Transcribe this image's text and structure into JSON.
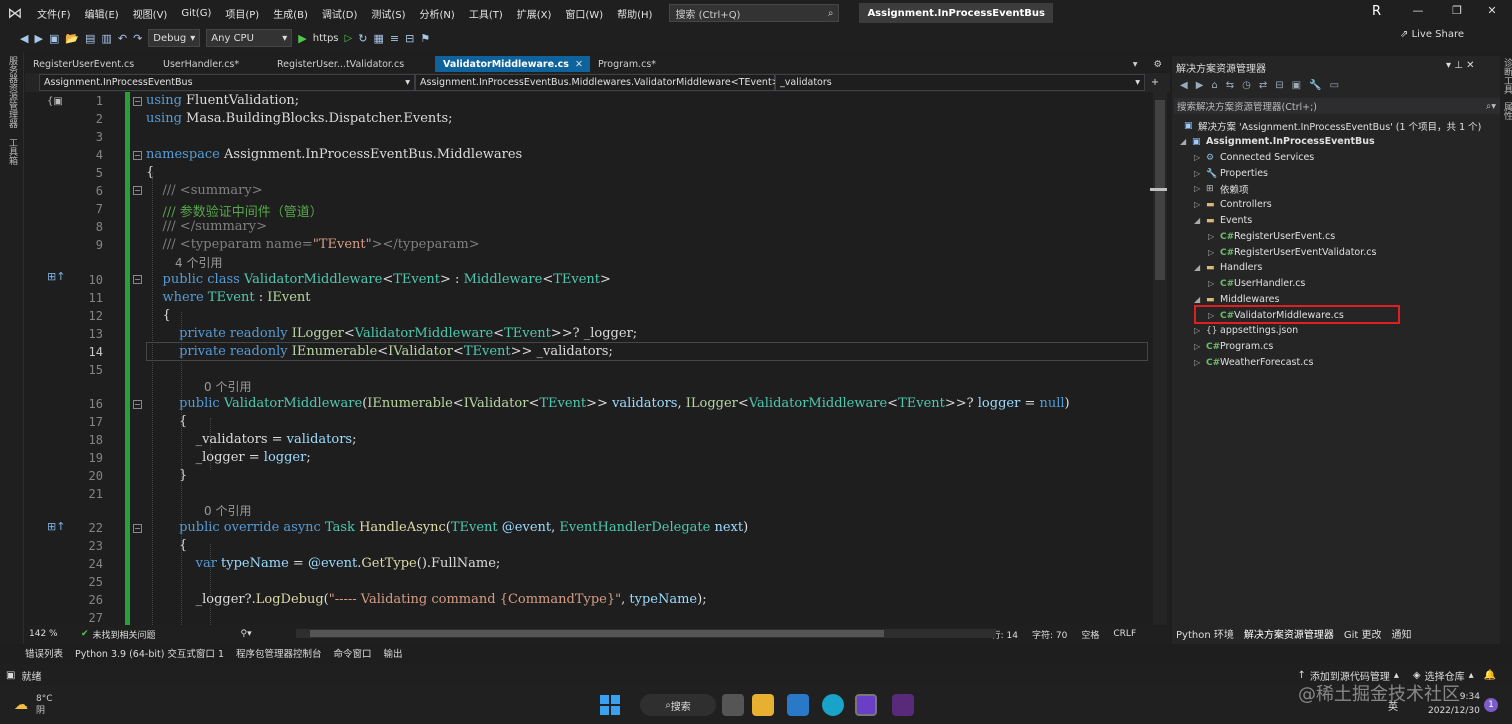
{
  "titlebar": {
    "menus": [
      "文件(F)",
      "编辑(E)",
      "视图(V)",
      "Git(G)",
      "项目(P)",
      "生成(B)",
      "调试(D)",
      "测试(S)",
      "分析(N)",
      "工具(T)",
      "扩展(X)",
      "窗口(W)",
      "帮助(H)"
    ],
    "search_placeholder": "搜索 (Ctrl+Q)",
    "solution_name": "Assignment.InProcessEventBus",
    "avatar": "R"
  },
  "toolbar": {
    "config": "Debug",
    "platform": "Any CPU",
    "run_label": "https",
    "live_share": "Live Share"
  },
  "left_strip": {
    "items": [
      "服务器资源管理器",
      "工具箱"
    ]
  },
  "tabs": [
    {
      "label": "RegisterUserEvent.cs",
      "active": false
    },
    {
      "label": "UserHandler.cs*",
      "active": false
    },
    {
      "label": "RegisterUser...tValidator.cs",
      "active": false
    },
    {
      "label": "ValidatorMiddleware.cs",
      "active": true
    },
    {
      "label": "Program.cs*",
      "active": false
    }
  ],
  "navbar": {
    "project": "Assignment.InProcessEventBus",
    "type": "Assignment.InProcessEventBus.Middlewares.ValidatorMiddleware<TEvent>",
    "member": "_validators"
  },
  "editor": {
    "ref4": "4 个引用",
    "ref0a": "0 个引用",
    "ref0b": "0 个引用",
    "line_numbers": [
      "1",
      "2",
      "3",
      "4",
      "5",
      "6",
      "7",
      "8",
      "9",
      "10",
      "11",
      "12",
      "13",
      "14",
      "15",
      "16",
      "17",
      "18",
      "19",
      "20",
      "21",
      "22",
      "23",
      "24",
      "25",
      "26",
      "27"
    ]
  },
  "editor_status": {
    "zoom": "142 %",
    "issues": "未找到相关问题",
    "line": "行: 14",
    "char": "字符: 70",
    "mode": "空格",
    "eol": "CRLF"
  },
  "solution_explorer": {
    "title": "解决方案资源管理器",
    "search_placeholder": "搜索解决方案资源管理器(Ctrl+;)",
    "solution": "解决方案 'Assignment.InProcessEventBus' (1 个项目，共 1 个)",
    "project": "Assignment.InProcessEventBus",
    "items": {
      "connected": "Connected Services",
      "properties": "Properties",
      "deps": "依赖项",
      "controllers": "Controllers",
      "events": "Events",
      "reg_event": "RegisterUserEvent.cs",
      "reg_validator": "RegisterUserEventValidator.cs",
      "handlers": "Handlers",
      "user_handler": "UserHandler.cs",
      "middlewares": "Middlewares",
      "validator_mw": "ValidatorMiddleware.cs",
      "appsettings": "appsettings.json",
      "program": "Program.cs",
      "weather": "WeatherForecast.cs"
    },
    "bottom_tabs": [
      "Python 环境",
      "解决方案资源管理器",
      "Git 更改",
      "通知"
    ],
    "right_strip": [
      "诊断工具",
      "属性"
    ]
  },
  "bottom_tabs": [
    "错误列表",
    "Python 3.9 (64-bit) 交互式窗口 1",
    "程序包管理器控制台",
    "命令窗口",
    "输出"
  ],
  "statusbar": {
    "ready": "就绪",
    "add_source": "添加到源代码管理",
    "repo": "选择仓库"
  },
  "taskbar": {
    "temp": "8°C",
    "weather": "阴",
    "search": "搜索",
    "ime": "英",
    "time": "9:34",
    "date": "2022/12/30",
    "badge": "1"
  },
  "watermark": "@稀土掘金技术社区",
  "colors": {
    "accent": "#0e639c",
    "keyword": "#569cd6",
    "type": "#4ec9b0",
    "comment": "#57a64a",
    "string": "#d69d85",
    "highlight": "#e02020"
  }
}
